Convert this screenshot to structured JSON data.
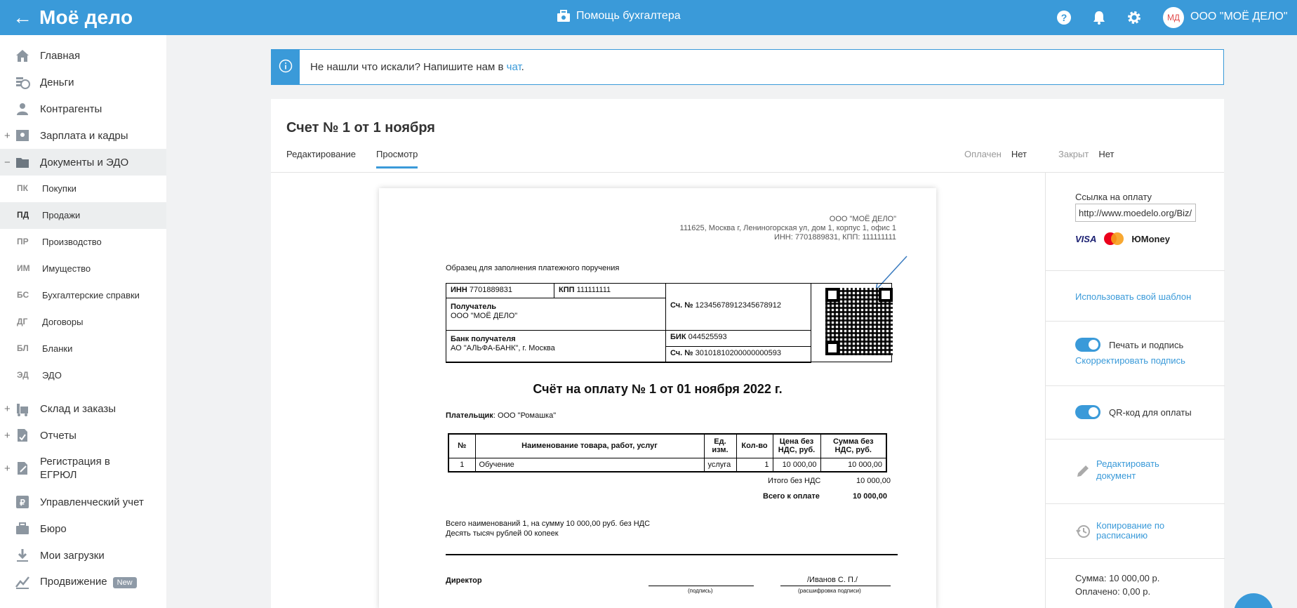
{
  "topbar": {
    "back_icon": "arrow-left-icon",
    "logo": "Моё дело",
    "center_label": "Помощь бухгалтера",
    "avatar_initials": "МД",
    "org_name": "ООО \"МОЁ ДЕЛО\""
  },
  "sidebar": {
    "items": [
      {
        "label": "Главная",
        "icon": "home-icon"
      },
      {
        "label": "Деньги",
        "icon": "money-icon"
      },
      {
        "label": "Контрагенты",
        "icon": "contacts-icon"
      },
      {
        "label": "Зарплата и кадры",
        "icon": "salary-icon"
      },
      {
        "label": "Документы и ЭДО",
        "icon": "folder-icon"
      },
      {
        "label": "Склад и заказы",
        "icon": "warehouse-icon"
      },
      {
        "label": "Отчеты",
        "icon": "report-icon"
      },
      {
        "label": "Регистрация в",
        "label2": "ЕГРЮЛ",
        "icon": "registration-icon"
      },
      {
        "label": "Управленческий учет",
        "icon": "management-icon"
      },
      {
        "label": "Бюро",
        "icon": "briefcase-icon"
      },
      {
        "label": "Мои загрузки",
        "icon": "download-icon"
      },
      {
        "label": "Продвижение",
        "badge": "New",
        "icon": "promotion-icon"
      }
    ],
    "subitems": [
      {
        "abbr": "ПК",
        "label": "Покупки"
      },
      {
        "abbr": "ПД",
        "label": "Продажи"
      },
      {
        "abbr": "ПР",
        "label": "Производство"
      },
      {
        "abbr": "ИМ",
        "label": "Имущество"
      },
      {
        "abbr": "БС",
        "label": "Бухгалтерские справки"
      },
      {
        "abbr": "ДГ",
        "label": "Договоры"
      },
      {
        "abbr": "БЛ",
        "label": "Бланки"
      },
      {
        "abbr": "ЭД",
        "label": "ЭДО"
      }
    ]
  },
  "banner": {
    "text": "Не нашли что искали? Напишите нам в ",
    "link": "чат",
    "tail": "."
  },
  "card": {
    "title": "Счет № 1 от 1 ноября",
    "tabs": [
      "Редактирование",
      "Просмотр"
    ],
    "status": {
      "paid_label": "Оплачен",
      "paid_value": "Нет",
      "closed_label": "Закрыт",
      "closed_value": "Нет"
    }
  },
  "invoice": {
    "seller_name": "ООО \"МОЁ ДЕЛО\"",
    "seller_address": "111625, Москва г, Лениногорская ул, дом 1, корпус 1, офис 1",
    "seller_inn_kpp": "ИНН: 7701889831, КПП: 111111111",
    "sample_label": "Образец для заполнения платежного поручения",
    "inn_label": "ИНН",
    "inn": "7701889831",
    "kpp_label": "КПП",
    "kpp": "111111111",
    "recipient_label": "Получатель",
    "recipient": "ООО \"МОЁ ДЕЛО\"",
    "account_label": "Сч. №",
    "account": "12345678912345678912",
    "bank_label": "Банк получателя",
    "bank": "АО \"АЛЬФА-БАНК\", г. Москва",
    "bik_label": "БИК",
    "bik": "044525593",
    "corr_label": "Сч. №",
    "corr": "30101810200000000593",
    "title": "Счёт на оплату № 1 от 01 ноября 2022 г.",
    "payer_label": "Плательщик",
    "payer": ": ООО \"Ромашка\"",
    "columns": [
      "№",
      "Наименование товара, работ, услуг",
      "Ед. изм.",
      "Кол-во",
      "Цена без НДС, руб.",
      "Сумма без НДС, руб."
    ],
    "rows": [
      [
        "1",
        "Обучение",
        "услуга",
        "1",
        "10 000,00",
        "10 000,00"
      ]
    ],
    "total_wo_vat_label": "Итого без НДС",
    "total_wo_vat": "10 000,00",
    "total_label": "Всего к оплате",
    "total": "10 000,00",
    "summary_line1": "Всего наименований 1, на сумму 10 000,00 руб. без НДС",
    "summary_line2": "Десять тысяч рублей 00 копеек",
    "director_label": "Директор",
    "signature_hint": "(подпись)",
    "director_name": "/Иванов С. П./",
    "decode_hint": "(расшифровка подписи)"
  },
  "right_panel": {
    "pay_link_label": "Ссылка на оплату",
    "pay_link_value": "http://www.moedelo.org/Biz/",
    "pay_brands": [
      "VISA",
      "MasterCard",
      "ЮMoney"
    ],
    "use_template": "Использовать свой шаблон",
    "print_sign_label": "Печать и подпись",
    "fix_sign_link": "Скорректировать подпись",
    "qr_label": "QR-код для оплаты",
    "edit_doc_line1": "Редактировать",
    "edit_doc_line2": "документ",
    "schedule_line1": "Копирование по",
    "schedule_line2": "расписанию",
    "sum_text": "Сумма: 10 000,00 р.",
    "paid_text": "Оплачено: 0,00 р."
  }
}
